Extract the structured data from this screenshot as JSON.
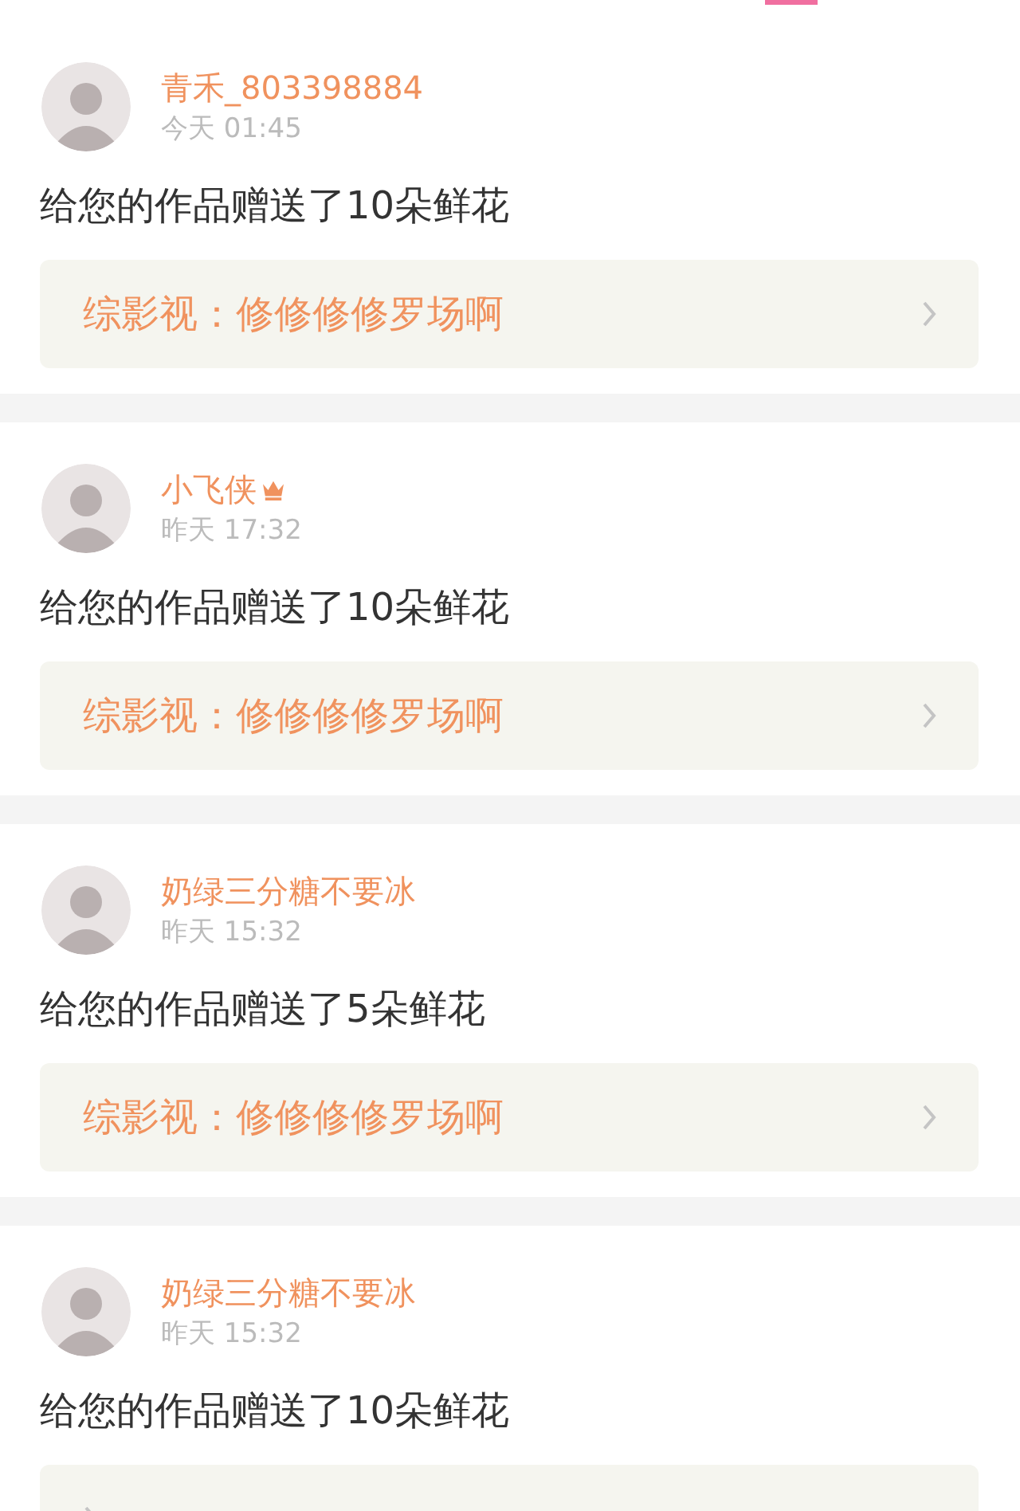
{
  "notifications": [
    {
      "user": "青禾_803398884",
      "vip": false,
      "time": "今天 01:45",
      "message": "给您的作品赠送了10朵鲜花",
      "work": "综影视：修修修修罗场啊"
    },
    {
      "user": "小飞侠",
      "vip": true,
      "time": "昨天 17:32",
      "message": "给您的作品赠送了10朵鲜花",
      "work": "综影视：修修修修罗场啊"
    },
    {
      "user": "奶绿三分糖不要冰",
      "vip": false,
      "time": "昨天 15:32",
      "message": "给您的作品赠送了5朵鲜花",
      "work": "综影视：修修修修罗场啊"
    },
    {
      "user": "奶绿三分糖不要冰",
      "vip": false,
      "time": "昨天 15:32",
      "message": "给您的作品赠送了10朵鲜花"
    }
  ]
}
